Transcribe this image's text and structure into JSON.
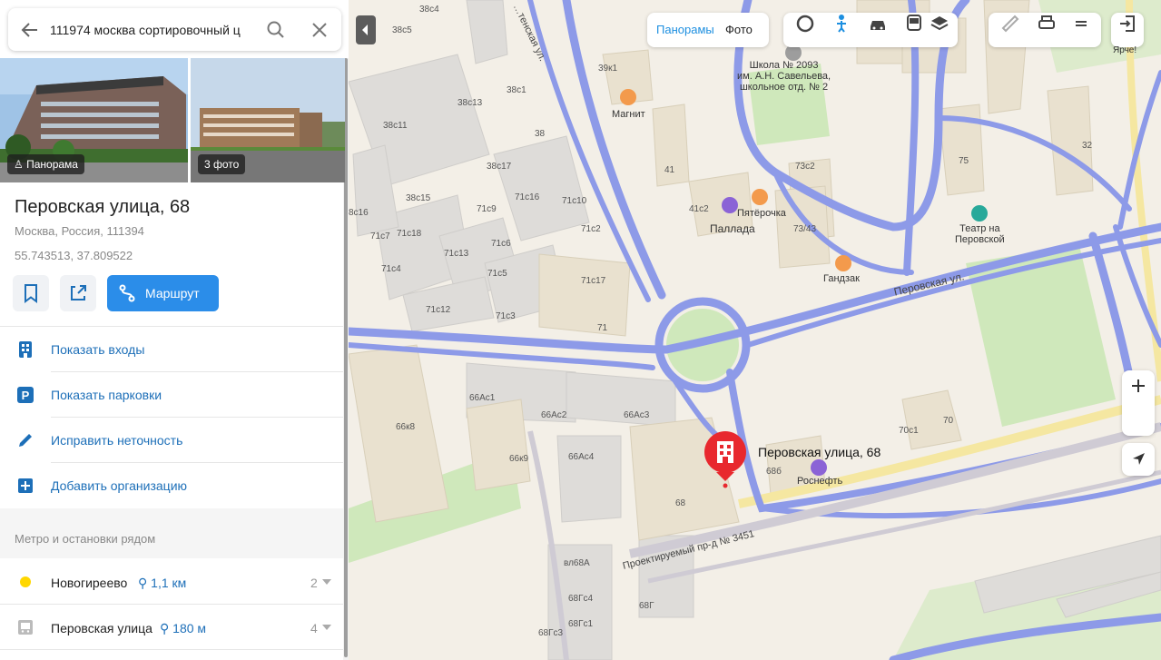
{
  "search": {
    "value": "111974 москва сортировочный ц"
  },
  "photos": {
    "panorama_label": "Панорама",
    "photos_label": "3 фото"
  },
  "place": {
    "title": "Перовская улица, 68",
    "subtitle": "Москва, Россия, 111394",
    "coords": "55.743513, 37.809522",
    "route_label": "Маршрут"
  },
  "actions": [
    {
      "label": "Показать входы",
      "icon": "building-entrance-icon"
    },
    {
      "label": "Показать парковки",
      "icon": "parking-icon"
    },
    {
      "label": "Исправить неточность",
      "icon": "pencil-icon"
    },
    {
      "label": "Добавить организацию",
      "icon": "plus-square-icon"
    }
  ],
  "nearby": {
    "title": "Метро и остановки рядом",
    "items": [
      {
        "name": "Новогиреево",
        "distance": "1,1 км",
        "count": "2",
        "icon": "metro-dot-icon",
        "color": "#ffd700"
      },
      {
        "name": "Перовская улица",
        "distance": "180 м",
        "count": "4",
        "icon": "bus-stop-icon"
      }
    ]
  },
  "map": {
    "tabs": {
      "panorama": "Панорамы",
      "photo": "Фото"
    },
    "yarche": "Ярче!",
    "pin_label": "Перовская улица, 68",
    "streets": {
      "perovskaya": "Перовская ул.",
      "proezd": "Проектируемый пр-д № 3451",
      "kazanskaya": "…тенская ул."
    },
    "pois": {
      "school": "Школа № 2093\nим. А.Н. Савельева,\nшкольное отд. № 2",
      "magnit": "Магнит",
      "pyaterochka": "Пятёрочка",
      "pallada": "Паллада",
      "gandzak": "Гандзак",
      "theatre": "Театр на\nПеровской",
      "rosneft": "Роснефть"
    },
    "buildings": [
      "38с4",
      "38с5",
      "39к1",
      "38с1",
      "38с13",
      "38с11",
      "38",
      "38с17",
      "38с15",
      "71с16",
      "71с10",
      "71с9",
      "8с16",
      "71с7",
      "71с18",
      "71с6",
      "71с2",
      "71с13",
      "71с4",
      "71с5",
      "71с17",
      "71с12",
      "71с3",
      "71",
      "41",
      "41с2",
      "73с2",
      "73/43",
      "75",
      "32",
      "66Ас1",
      "66Ас2",
      "66Ас3",
      "66к8",
      "66к9",
      "66Ас4",
      "68",
      "68б",
      "70с1",
      "70",
      "вл68А",
      "68Гс4",
      "68Г",
      "68Гс1",
      "68Гс3"
    ],
    "colors": {
      "road": "#8d9ae8",
      "park": "#c8e6b0",
      "building": "#dcdad7",
      "pin": "#e8282e"
    }
  }
}
